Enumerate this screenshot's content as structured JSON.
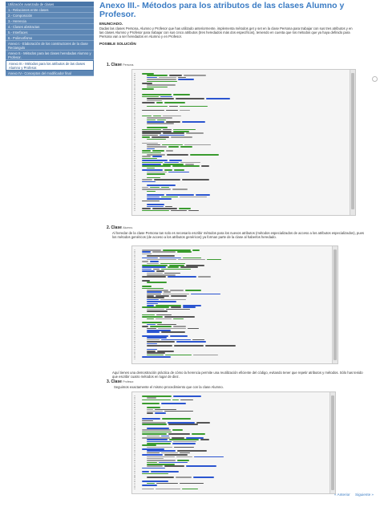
{
  "sidebar": {
    "items": [
      {
        "label": "Utilización avanzada de clases",
        "kind": "head"
      },
      {
        "label": "1.- Relaciones entre clases",
        "kind": "normal"
      },
      {
        "label": "2.- Composición",
        "kind": "normal"
      },
      {
        "label": "3.- Herencia",
        "kind": "normal"
      },
      {
        "label": "4.- Clases abstractas",
        "kind": "normal"
      },
      {
        "label": "5.- Interfaces",
        "kind": "normal"
      },
      {
        "label": "6.- Polimorfismo",
        "kind": "normal"
      },
      {
        "label": "Anexo I.- Elaboración de los constructores de la clase Rectangulo",
        "kind": "normal"
      },
      {
        "label": "Anexo II.- Métodos para las clases heredadas Alumno y Profesor.",
        "kind": "normal"
      },
      {
        "label": "Anexo III.- Métodos para los atributos de las clases Alumno y Profesor.",
        "kind": "active"
      },
      {
        "label": "Anexo IV.- Conceptos del modificador final",
        "kind": "normal"
      }
    ]
  },
  "main": {
    "title": "Anexo III.- Métodos para los atributos de las clases Alumno y Profesor.",
    "enunciado_heading": "ENUNCIADO.",
    "enunciado_text": "Dadas las clases Persona, Alumno y Profesor que has utilizado anteriormente, implementa métodos get y set en la clase Persona para trabajar con sus tres atributos y en las clases Alumno y Profesor para trabajar con sus cinco atributos (tres heredados más dos específicos), teniendo en cuenta que los métodos que ya haya definido para Persona van a ser heredados en Alumno y en Profesor.",
    "solucion_heading": "POSIBLE SOLUCIÓN",
    "steps": [
      {
        "label": "1. Clase",
        "name": "Persona."
      },
      {
        "label": "2. Clase",
        "name": "Alumno."
      },
      {
        "label": "3. Clase",
        "name": "Profesor."
      }
    ],
    "alumno_text": "Al heredar de la clase Persona tan solo es necesario escribir métodos para los nuevos atributos (métodos especializados de acceso a los atributos especializados), pues los métodos genéricos (de acceso a los atributos genéricos) ya forman parte de la clase al haberlos heredado.",
    "alumno_after": "Aquí tienes una demostración práctica de cómo la herencia permite una reutilización eficiente del código, evitando tener que repetir atributos y métodos. Sólo has tenido que escribir cuatro métodos en lugar de diez.",
    "profesor_text": "Seguimos exactamente el mismo procedimiento que con la clase Alumno."
  },
  "colors": {
    "accent": "#3b7cc4",
    "sidebar_bg": "#5d87b5",
    "code_bg": "#f5f5f5",
    "kw_green": "#3a9b2f",
    "kw_blue": "#2b55d0",
    "comment_gray": "#9a9a9a"
  },
  "nav": {
    "prev_label": "« Anterior",
    "next_label": "Siguiente »"
  }
}
